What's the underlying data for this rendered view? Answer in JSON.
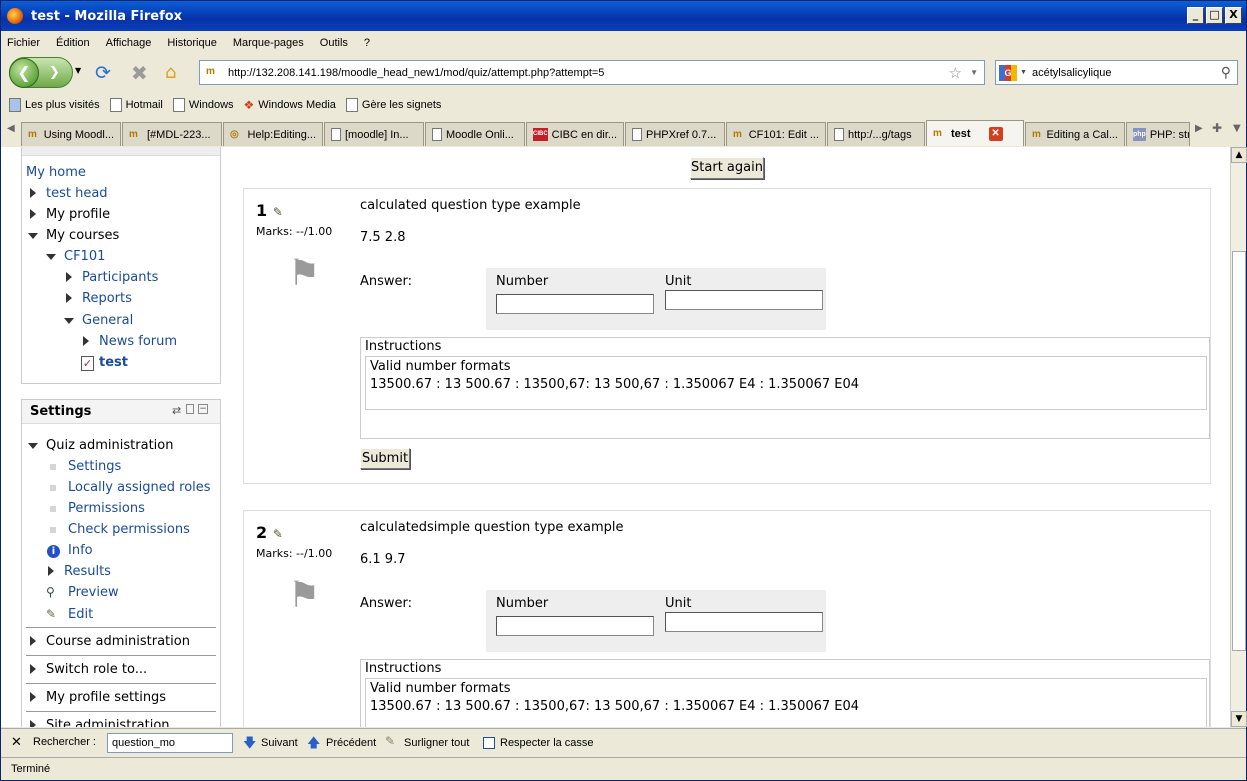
{
  "window": {
    "title": "test - Mozilla Firefox",
    "min": "_",
    "max": "□",
    "close": "X"
  },
  "menu": [
    "Fichier",
    "Édition",
    "Affichage",
    "Historique",
    "Marque-pages",
    "Outils",
    "?"
  ],
  "nav": {
    "url": "http://132.208.141.198/moodle_head_new1/mod/quiz/attempt.php?attempt=5",
    "search_value": "acétylsalicylique",
    "site_icon": "m"
  },
  "bookmarks": [
    "Les plus visités",
    "Hotmail",
    "Windows",
    "Windows Media",
    "Gère les signets"
  ],
  "tabs": [
    {
      "label": "Using Moodl...",
      "icon": "m"
    },
    {
      "label": "[#MDL-223...",
      "icon": "m"
    },
    {
      "label": "Help:Editing...",
      "icon": "◎"
    },
    {
      "label": "[moodle] In...",
      "icon": ""
    },
    {
      "label": "Moodle Onli...",
      "icon": ""
    },
    {
      "label": "CIBC en dir...",
      "icon": "CIBC"
    },
    {
      "label": "PHPXref 0.7...",
      "icon": ""
    },
    {
      "label": "CF101: Edit ...",
      "icon": "m"
    },
    {
      "label": "http:/...g/tags",
      "icon": ""
    },
    {
      "label": "test",
      "icon": "m",
      "active": true
    },
    {
      "label": "Editing a Cal...",
      "icon": "m"
    },
    {
      "label": "PHP: str...",
      "icon": "php"
    }
  ],
  "navigation": {
    "items": [
      "My home",
      "test head",
      "My profile",
      "My courses",
      "CF101",
      "Participants",
      "Reports",
      "General",
      "News forum",
      "test"
    ]
  },
  "settings": {
    "title": "Settings",
    "items": [
      "Quiz administration",
      "Settings",
      "Locally assigned roles",
      "Permissions",
      "Check permissions",
      "Info",
      "Results",
      "Preview",
      "Edit",
      "Course administration",
      "Switch role to...",
      "My profile settings",
      "Site administration"
    ]
  },
  "quiz": {
    "start_again": "Start again",
    "questions": [
      {
        "num": "1",
        "marks": "Marks: --/1.00",
        "title": "calculated question type example",
        "values": "7.5 2.8",
        "answer_label": "Answer:",
        "number_label": "Number",
        "unit_label": "Unit",
        "instr_title": "Instructions",
        "instr_line1": "Valid number formats",
        "instr_line2": "13500.67 : 13 500.67 : 13500,67: 13 500,67 : 1.350067 E4 : 1.350067 E04",
        "submit": "Submit"
      },
      {
        "num": "2",
        "marks": "Marks: --/1.00",
        "title": "calculatedsimple question type example",
        "values": "6.1 9.7",
        "answer_label": "Answer:",
        "number_label": "Number",
        "unit_label": "Unit",
        "instr_title": "Instructions",
        "instr_line1": "Valid number formats",
        "instr_line2": "13500.67 : 13 500.67 : 13500,67: 13 500,67 : 1.350067 E4 : 1.350067 E04"
      }
    ]
  },
  "findbar": {
    "label": "Rechercher :",
    "value": "question_mo",
    "next": "Suivant",
    "prev": "Précédent",
    "highlight": "Surligner tout",
    "matchcase": "Respecter la casse"
  },
  "status": "Terminé"
}
